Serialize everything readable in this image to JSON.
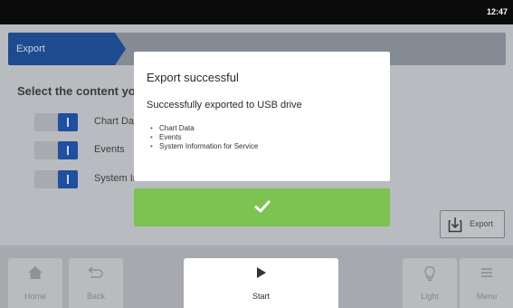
{
  "status": {
    "time": "12:47"
  },
  "header": {
    "breadcrumb": "Export"
  },
  "content": {
    "prompt": "Select the content you want to export",
    "options": [
      {
        "label": "Chart Data",
        "checked": true
      },
      {
        "label": "Events",
        "checked": true
      },
      {
        "label": "System Information for Service",
        "checked": true
      }
    ],
    "export_button": {
      "label": "Export",
      "icon": "export-icon"
    }
  },
  "dialog": {
    "title": "Export successful",
    "message": "Successfully exported to USB drive",
    "items": [
      "Chart Data",
      "Events",
      "System Information for Service"
    ],
    "confirm_icon": "check-icon"
  },
  "nav": {
    "home": {
      "label": "Home",
      "icon": "home-icon"
    },
    "back": {
      "label": "Back",
      "icon": "back-icon"
    },
    "start": {
      "label": "Start",
      "icon": "play-icon"
    },
    "light": {
      "label": "Light",
      "icon": "lightbulb-icon"
    },
    "menu": {
      "label": "Menu",
      "icon": "menu-icon"
    }
  },
  "colors": {
    "accent_blue": "#1e4a8f",
    "success_green": "#7cc352",
    "status_bar": "#0b0b0b"
  }
}
